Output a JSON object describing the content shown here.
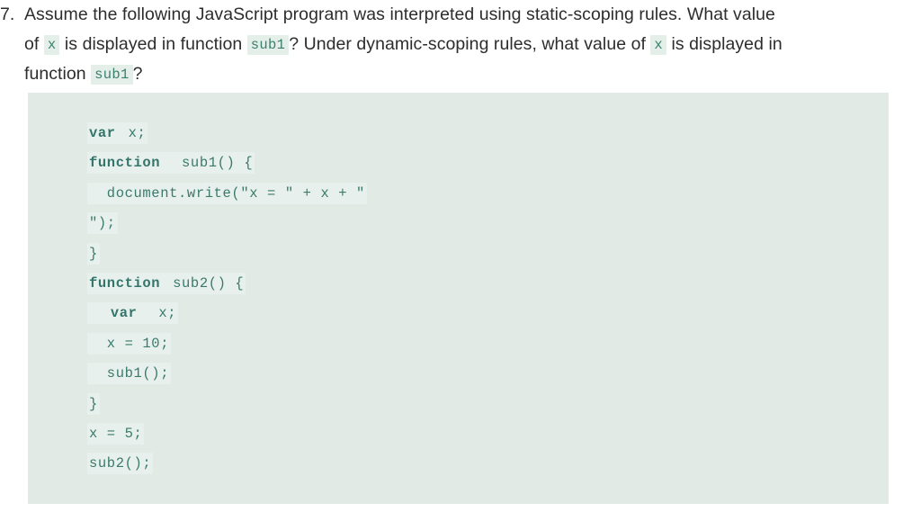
{
  "question": {
    "marker": "7.",
    "line1_text": "Assume the following JavaScript program was interpreted using static-scoping rules. What value",
    "line2_part1": "of",
    "line2_code1": "x",
    "line2_part2": "is displayed in function",
    "line2_code2": "sub1",
    "line2_part3": "? Under dynamic-scoping rules, what value of",
    "line2_code3": "x",
    "line2_part4": "is displayed in",
    "line3_part1": "function",
    "line3_code1": "sub1",
    "line3_part2": "?"
  },
  "code_block": {
    "language": "javascript",
    "background_color": "#e2eae6",
    "line_highlight_color": "#e8f0ed",
    "text_color": "#3a7a6a",
    "lines": [
      {
        "keyword": "var",
        "rest": " x;"
      },
      {
        "keyword": "function",
        "rest": "  sub1() {"
      },
      {
        "keyword": "",
        "rest": "  document.write(\"x = \" + x + \""
      },
      {
        "keyword": "",
        "rest": "\");"
      },
      {
        "keyword": "",
        "rest": "}"
      },
      {
        "keyword": "function",
        "rest": " sub2() {"
      },
      {
        "keyword": "",
        "rest": "  "
      },
      {
        "keyword": "",
        "rest": "  x = 10;"
      },
      {
        "keyword": "",
        "rest": "  sub1();"
      },
      {
        "keyword": "",
        "rest": "}"
      },
      {
        "keyword": "",
        "rest": "x = 5;"
      },
      {
        "keyword": "",
        "rest": "sub2();"
      }
    ],
    "line_6_keyword": "var",
    "line_6_rest": "  x;",
    "line_6_indent": "  "
  }
}
